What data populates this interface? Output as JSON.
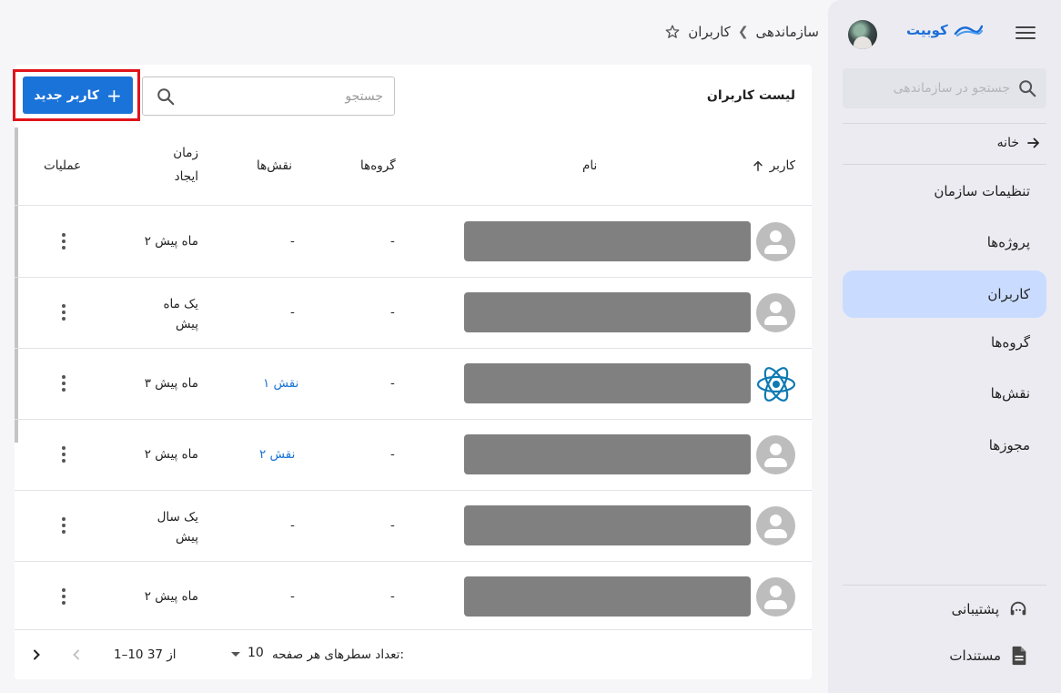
{
  "sidebar": {
    "brand_name": "کوبیت",
    "search_placeholder": "جستجو در سازماندهی",
    "home_label": "خانه",
    "items": [
      {
        "label": "تنظیمات سازمان",
        "active": false
      },
      {
        "label": "پروژه‌ها",
        "active": false
      },
      {
        "label": "کاربران",
        "active": true
      },
      {
        "label": "گروه‌ها",
        "active": false
      },
      {
        "label": "نقش‌ها",
        "active": false
      },
      {
        "label": "مجوزها",
        "active": false
      }
    ],
    "support_label": "پشتیبانی",
    "docs_label": "مستندات"
  },
  "breadcrumb": {
    "parent": "سازماندهی",
    "current": "کاربران"
  },
  "main": {
    "title": "لیست کاربران",
    "new_user_label": "کاربر جدید",
    "search_placeholder": "جستجو",
    "columns": {
      "user": "کاربر",
      "name": "نام",
      "groups": "گروه‌ها",
      "roles": "نقش‌ها",
      "created_line1": "زمان",
      "created_line2": "ایجاد",
      "actions": "عملیات"
    },
    "rows": [
      {
        "avatar": "person-icon",
        "groups": "-",
        "roles": "-",
        "created_line1": "۲ ماه پیش",
        "created_line2": ""
      },
      {
        "avatar": "person-icon",
        "groups": "-",
        "roles": "-",
        "created_line1": "یک ماه",
        "created_line2": "پیش"
      },
      {
        "avatar": "react-logo-icon",
        "groups": "-",
        "roles": "۱ نقش",
        "created_line1": "۳ ماه پیش",
        "created_line2": ""
      },
      {
        "avatar": "person-icon",
        "groups": "-",
        "roles": "۲ نقش",
        "created_line1": "۲ ماه پیش",
        "created_line2": ""
      },
      {
        "avatar": "person-icon",
        "groups": "-",
        "roles": "-",
        "created_line1": "یک سال",
        "created_line2": "پیش"
      },
      {
        "avatar": "person-icon",
        "groups": "-",
        "roles": "-",
        "created_line1": "۲ ماه پیش",
        "created_line2": ""
      }
    ],
    "footer": {
      "rows_per_page_label": "تعداد سطرهای هر صفحه:",
      "rows_per_page_value": "10",
      "range_text": "1–10 از 37"
    }
  },
  "colors": {
    "accent": "#1a73d9",
    "active_nav": "#c9dcff",
    "highlight": "#e0141b"
  }
}
